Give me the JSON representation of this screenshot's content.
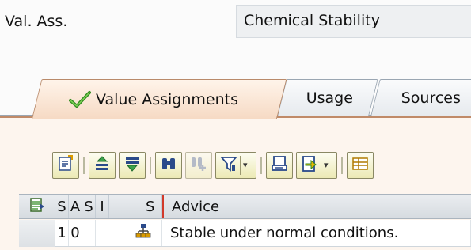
{
  "value_assessment": {
    "label": "Val. Ass.",
    "value": "Chemical Stability"
  },
  "tabs": [
    {
      "label": "Value Assignments",
      "icon": "checkmark-icon",
      "active": true
    },
    {
      "label": "Usage",
      "active": false
    },
    {
      "label": "Sources",
      "active": false
    }
  ],
  "toolbar": {
    "buttons": [
      "details-icon",
      "print-icon",
      "filter-icon",
      "find-icon",
      "find-next-icon",
      "set-filter-icon",
      "print-preview-icon",
      "export-icon",
      "layout-icon"
    ]
  },
  "table": {
    "columns": [
      "S",
      "A",
      "S",
      "I",
      "S",
      "Advice"
    ],
    "rows": [
      {
        "s1": "1",
        "a": "0",
        "s2": "",
        "i_icon": "hierarchy-icon",
        "s3": "",
        "advice": "Stable under normal conditions."
      }
    ]
  },
  "colors": {
    "active_tab": "#f6dac4",
    "panel": "#fdf5ee",
    "toolbar_button": "#ece9b4"
  }
}
